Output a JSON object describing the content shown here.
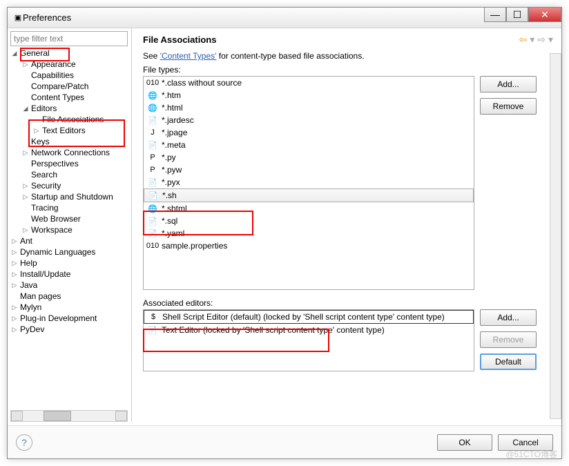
{
  "window": {
    "title": "Preferences"
  },
  "filter": {
    "placeholder": "type filter text"
  },
  "tree": {
    "general": "General",
    "appearance": "Appearance",
    "capabilities": "Capabilities",
    "compare": "Compare/Patch",
    "contentTypes": "Content Types",
    "editors": "Editors",
    "fileAssoc": "File Associations",
    "textEditors": "Text Editors",
    "keys": "Keys",
    "network": "Network Connections",
    "perspectives": "Perspectives",
    "search": "Search",
    "security": "Security",
    "startup": "Startup and Shutdown",
    "tracing": "Tracing",
    "webBrowser": "Web Browser",
    "workspace": "Workspace",
    "ant": "Ant",
    "dynLang": "Dynamic Languages",
    "help": "Help",
    "installUpdate": "Install/Update",
    "java": "Java",
    "manPages": "Man pages",
    "mylyn": "Mylyn",
    "pluginDev": "Plug-in Development",
    "pydev": "PyDev"
  },
  "main": {
    "title": "File Associations",
    "seeText": "See ",
    "contentTypesLink": "'Content Types'",
    "seeText2": " for content-type based file associations.",
    "fileTypesLabel": "File types:",
    "assocLabel": "Associated editors:"
  },
  "fileTypes": [
    {
      "name": "*.class without source",
      "icon": "010"
    },
    {
      "name": "*.htm",
      "icon": "🌐"
    },
    {
      "name": "*.html",
      "icon": "🌐"
    },
    {
      "name": "*.jardesc",
      "icon": "📄"
    },
    {
      "name": "*.jpage",
      "icon": "J"
    },
    {
      "name": "*.meta",
      "icon": "📄"
    },
    {
      "name": "*.py",
      "icon": "P"
    },
    {
      "name": "*.pyw",
      "icon": "P"
    },
    {
      "name": "*.pyx",
      "icon": "📄"
    },
    {
      "name": "*.sh",
      "icon": "📄",
      "selected": true
    },
    {
      "name": "*.shtml",
      "icon": "🌐"
    },
    {
      "name": "*.sql",
      "icon": "📄"
    },
    {
      "name": "*.yaml",
      "icon": "📄"
    },
    {
      "name": "sample.properties",
      "icon": "010"
    }
  ],
  "editors": [
    {
      "name": "Shell Script Editor (default) (locked by 'Shell script content type' content type)",
      "icon": "$",
      "selected": true
    },
    {
      "name": "Text Editor (locked by 'Shell script content type' content type)",
      "icon": "📄"
    }
  ],
  "buttons": {
    "add": "Add...",
    "remove": "Remove",
    "default": "Default",
    "ok": "OK",
    "cancel": "Cancel"
  },
  "watermark": "@51CTO博客"
}
